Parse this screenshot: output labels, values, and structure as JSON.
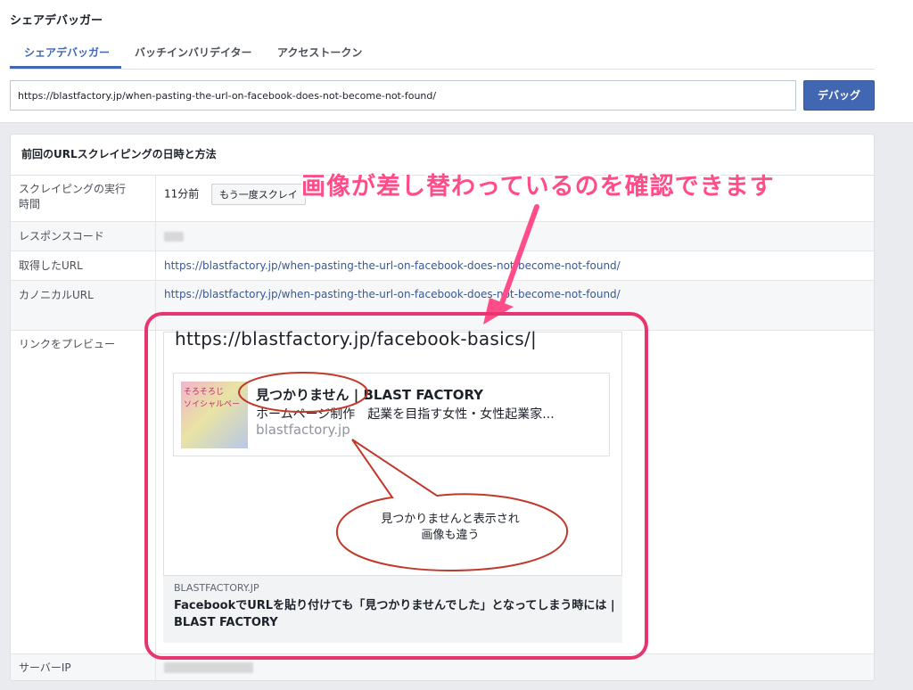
{
  "app": {
    "title": "シェアデバッガー"
  },
  "tabs": [
    {
      "label": "シェアデバッガー",
      "active": true
    },
    {
      "label": "バッチインバリデイター",
      "active": false
    },
    {
      "label": "アクセストークン",
      "active": false
    }
  ],
  "url_input": {
    "value": "https://blastfactory.jp/when-pasting-the-url-on-facebook-does-not-become-not-found/"
  },
  "debug_button": {
    "label": "デバッグ"
  },
  "panel": {
    "header": "前回のURLスクレイピングの日時と方法",
    "rows": {
      "scrape_time": {
        "label_line1": "スクレイピングの実行",
        "label_line2": "時間",
        "value": "11分前",
        "button": "もう一度スクレイ"
      },
      "response_code": {
        "label": "レスポンスコード"
      },
      "fetched_url": {
        "label": "取得したURL",
        "value": "https://blastfactory.jp/when-pasting-the-url-on-facebook-does-not-become-not-found/"
      },
      "canonical_url": {
        "label": "カノニカルURL",
        "value": "https://blastfactory.jp/when-pasting-the-url-on-facebook-does-not-become-not-found/"
      },
      "link_preview": {
        "label": "リンクをプレビュー"
      },
      "server_ip": {
        "label": "サーバーIP"
      }
    }
  },
  "preview": {
    "typed_url": "https://blastfactory.jp/facebook-basics/|",
    "inner_card": {
      "thumb_text": "そろそろじ\nソイシャルペー",
      "title": "見つかりません | BLAST FACTORY",
      "description": "ホームページ制作　起業を目指す女性・女性起業家...",
      "domain": "blastfactory.jp"
    },
    "meta_domain": "BLASTFACTORY.JP",
    "meta_title": "FacebookでURLを貼り付けても「見つかりませんでした」となってしまう時には | BLAST FACTORY"
  },
  "annotations": {
    "headline": "画像が差し替わっているのを確認できます",
    "bubble_line1": "見つかりませんと表示され",
    "bubble_line2": "画像も違う",
    "accent_color": "#e8356d"
  }
}
